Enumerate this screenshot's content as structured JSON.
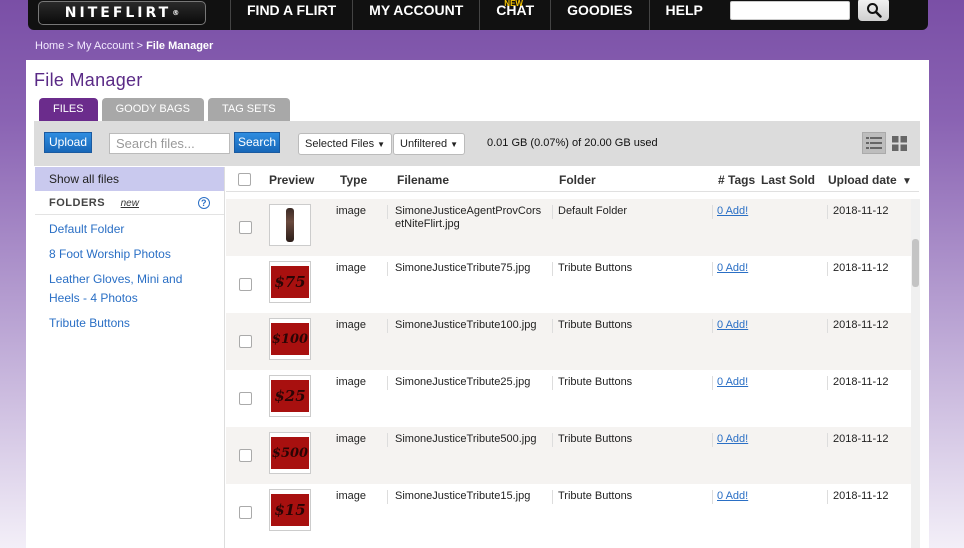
{
  "nav": {
    "logo": "NITEFLIRT",
    "logo_mark": "®",
    "items": [
      {
        "label": "FIND A FLIRT"
      },
      {
        "label": "MY ACCOUNT"
      },
      {
        "label": "CHAT",
        "badge": "NEW"
      },
      {
        "label": "GOODIES"
      },
      {
        "label": "HELP"
      }
    ],
    "search_placeholder": ""
  },
  "breadcrumb": {
    "home": "Home",
    "account": "My Account",
    "current": "File Manager",
    "sep": ">"
  },
  "page": {
    "title": "File Manager"
  },
  "tabs": [
    {
      "label": "FILES",
      "active": true
    },
    {
      "label": "GOODY BAGS",
      "active": false
    },
    {
      "label": "TAG SETS",
      "active": false
    }
  ],
  "toolbar": {
    "upload_label": "Upload",
    "search_placeholder": "Search files...",
    "search_label": "Search",
    "selected_files_label": "Selected Files",
    "filter_label": "Unfiltered",
    "usage_text": "0.01 GB (0.07%) of 20.00 GB used"
  },
  "sidebar": {
    "show_all": "Show all files",
    "folders_label": "FOLDERS",
    "new_label": "new",
    "help_glyph": "?",
    "folders": [
      "Default Folder",
      "8 Foot Worship Photos",
      "Leather Gloves, Mini and Heels - 4 Photos",
      "Tribute Buttons"
    ]
  },
  "table": {
    "headers": {
      "preview": "Preview",
      "type": "Type",
      "filename": "Filename",
      "folder": "Folder",
      "tags": "# Tags",
      "last_sold": "Last Sold",
      "upload_date": "Upload date",
      "sort_indicator": "▼"
    },
    "rows": [
      {
        "thumb": "photo",
        "thumb_text": "",
        "type": "image",
        "filename": "SimoneJusticeAgentProvCorsetNiteFlirt.jpg",
        "folder": "Default Folder",
        "tags": "0 Add!",
        "last_sold": "",
        "upload_date": "2018-11-12"
      },
      {
        "thumb": "red",
        "thumb_text": "$75",
        "type": "image",
        "filename": "SimoneJusticeTribute75.jpg",
        "folder": "Tribute Buttons",
        "tags": "0 Add!",
        "last_sold": "",
        "upload_date": "2018-11-12"
      },
      {
        "thumb": "red",
        "thumb_text": "$100",
        "type": "image",
        "filename": "SimoneJusticeTribute100.jpg",
        "folder": "Tribute Buttons",
        "tags": "0 Add!",
        "last_sold": "",
        "upload_date": "2018-11-12"
      },
      {
        "thumb": "red",
        "thumb_text": "$25",
        "type": "image",
        "filename": "SimoneJusticeTribute25.jpg",
        "folder": "Tribute Buttons",
        "tags": "0 Add!",
        "last_sold": "",
        "upload_date": "2018-11-12"
      },
      {
        "thumb": "red",
        "thumb_text": "$500",
        "type": "image",
        "filename": "SimoneJusticeTribute500.jpg",
        "folder": "Tribute Buttons",
        "tags": "0 Add!",
        "last_sold": "",
        "upload_date": "2018-11-12"
      },
      {
        "thumb": "red",
        "thumb_text": "$15",
        "type": "image",
        "filename": "SimoneJusticeTribute15.jpg",
        "folder": "Tribute Buttons",
        "tags": "0 Add!",
        "last_sold": "",
        "upload_date": "2018-11-12"
      }
    ]
  },
  "colors": {
    "brand_purple": "#6b2c8c",
    "link_blue": "#2a6fc5",
    "tribute_red": "#a8100f"
  }
}
